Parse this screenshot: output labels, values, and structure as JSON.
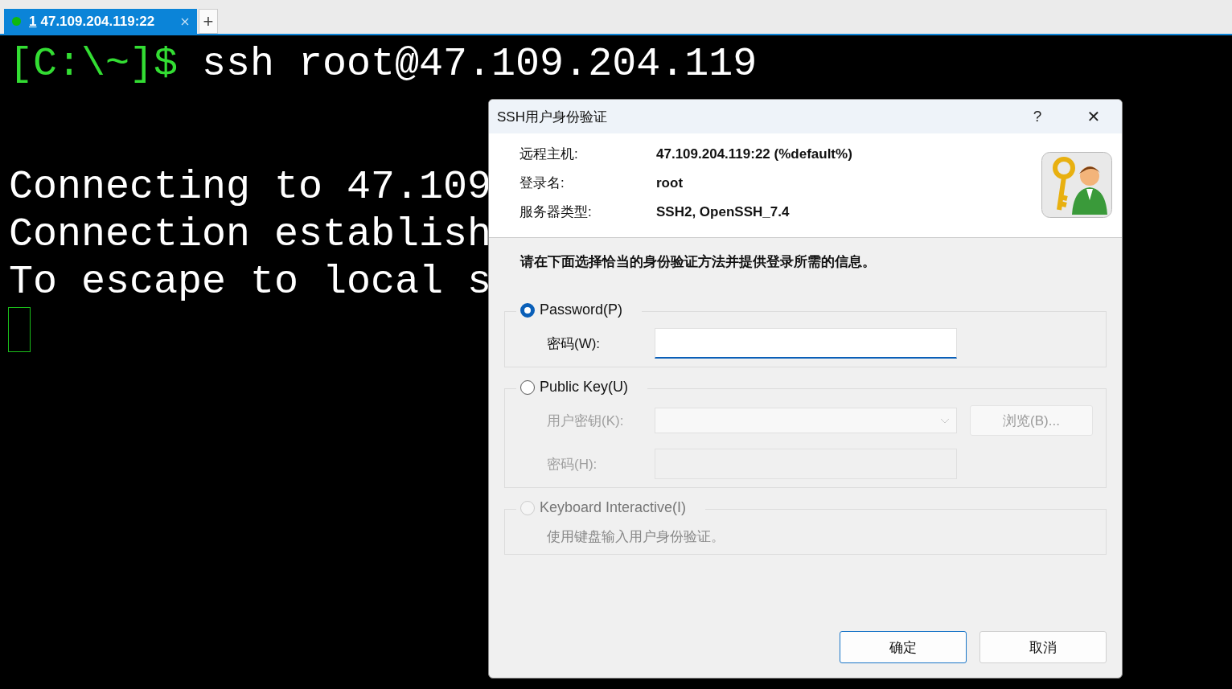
{
  "tabs": [
    {
      "number": "1",
      "title": "47.109.204.119:22",
      "selected": true,
      "connected": true
    }
  ],
  "new_tab_button": "+",
  "terminal": {
    "prompt": "[C:\\~]$",
    "command": " ssh root@47.109.204.119",
    "lines": [
      "Connecting to 47.109",
      "Connection establish",
      "To escape to local s"
    ]
  },
  "dialog": {
    "title": "SSH用户身份验证",
    "help": "?",
    "close": "✕",
    "info": [
      {
        "label": "远程主机:",
        "value": "47.109.204.119:22 (%default%)"
      },
      {
        "label": "登录名:",
        "value": "root"
      },
      {
        "label": "服务器类型:",
        "value": "SSH2, OpenSSH_7.4"
      }
    ],
    "instruction": "请在下面选择恰当的身份验证方法并提供登录所需的信息。",
    "methods": [
      {
        "label": "Password(P)",
        "selected": true,
        "disabled": false,
        "fields": [
          {
            "label": "密码(W):",
            "kind": "input",
            "disabled": false
          }
        ]
      },
      {
        "label": "Public Key(U)",
        "selected": false,
        "disabled": false,
        "fields": [
          {
            "label": "用户密钥(K):",
            "kind": "dropdown",
            "disabled": true
          },
          {
            "label": "密码(H):",
            "kind": "input",
            "disabled": true
          }
        ],
        "button": {
          "label": "浏览(B)...",
          "disabled": true
        }
      },
      {
        "label": "Keyboard Interactive(I)",
        "selected": false,
        "disabled": true,
        "description": "使用键盘输入用户身份验证。"
      }
    ],
    "buttons": [
      {
        "label": "确定",
        "default": true
      },
      {
        "label": "取消",
        "default": false
      }
    ]
  }
}
